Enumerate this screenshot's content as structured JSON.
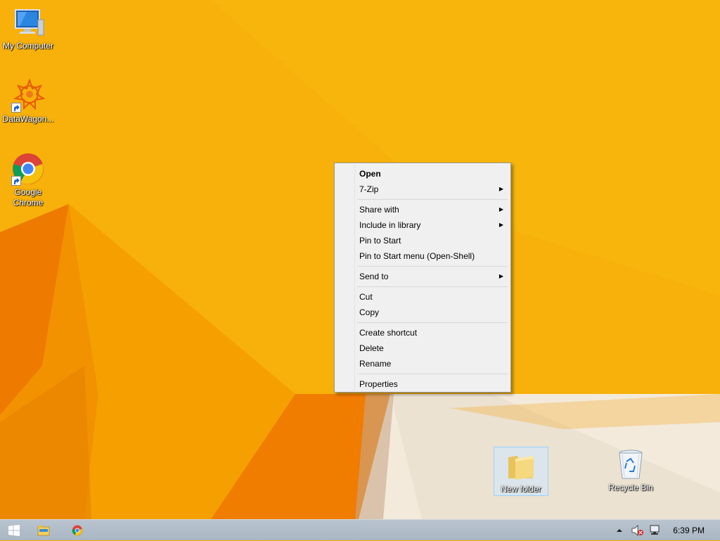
{
  "desktop": {
    "icons": [
      {
        "label": "My Computer",
        "icon": "computer-icon"
      },
      {
        "label": "DataWagon...",
        "icon": "datawagon-icon"
      },
      {
        "label": "Google\nChrome",
        "label_line1": "Google",
        "label_line2": "Chrome",
        "icon": "chrome-icon"
      },
      {
        "label": "New folder",
        "icon": "folder-icon",
        "selected": true
      },
      {
        "label": "Recycle Bin",
        "icon": "recycle-bin-icon"
      }
    ]
  },
  "context_menu": {
    "groups": [
      [
        {
          "label": "Open",
          "bold": true
        },
        {
          "label": "7-Zip",
          "submenu": true
        }
      ],
      [
        {
          "label": "Share with",
          "submenu": true
        },
        {
          "label": "Include in library",
          "submenu": true
        },
        {
          "label": "Pin to Start"
        },
        {
          "label": "Pin to Start menu (Open-Shell)"
        }
      ],
      [
        {
          "label": "Send to",
          "submenu": true
        }
      ],
      [
        {
          "label": "Cut"
        },
        {
          "label": "Copy"
        }
      ],
      [
        {
          "label": "Create shortcut"
        },
        {
          "label": "Delete"
        },
        {
          "label": "Rename"
        }
      ],
      [
        {
          "label": "Properties"
        }
      ]
    ]
  },
  "taskbar": {
    "buttons": [
      "start-button",
      "file-explorer-button",
      "chrome-button"
    ],
    "tray": {
      "clock": "6:39 PM",
      "icons": [
        "show-hidden-icons-icon",
        "volume-muted-icon",
        "network-icon"
      ]
    }
  },
  "colors": {
    "wallpaper_main": "#f5a900",
    "wallpaper_dark": "#e06a00",
    "wallpaper_light": "#f5ede0",
    "menu_bg": "#f0f0f0",
    "taskbar": "#aeb9c5"
  }
}
